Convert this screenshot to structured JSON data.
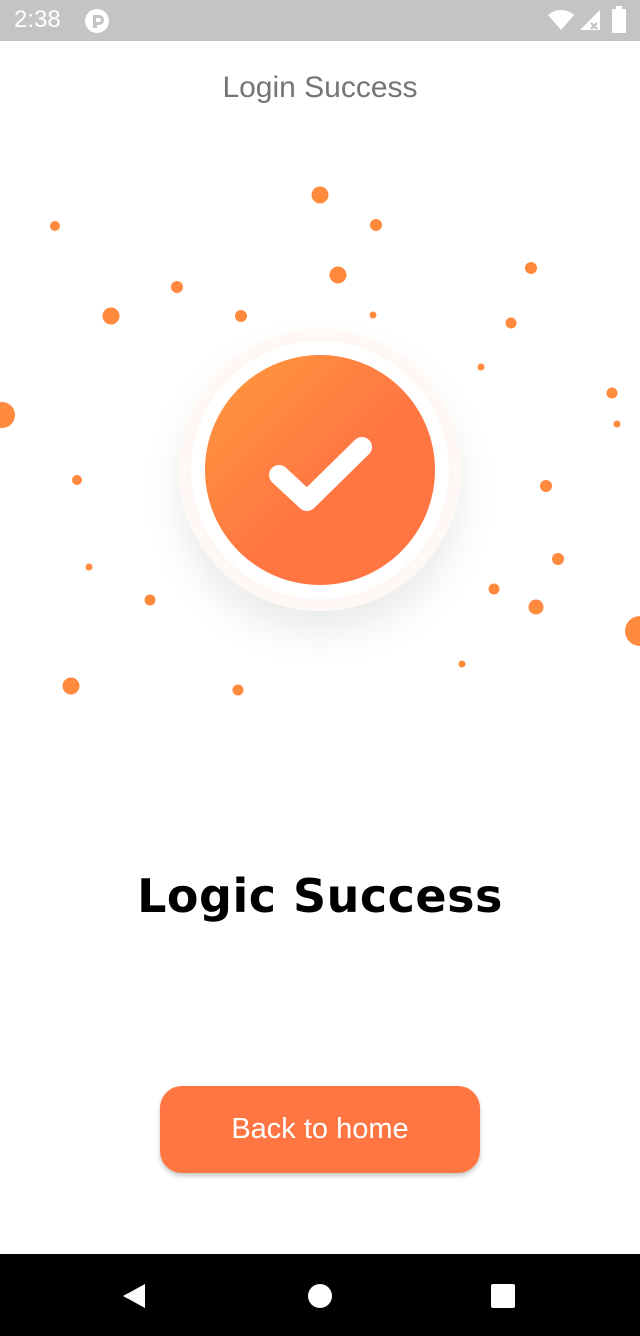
{
  "status_bar": {
    "time": "2:38",
    "icons": [
      "app-notification-icon",
      "wifi-icon",
      "cell-signal-icon",
      "battery-icon"
    ]
  },
  "app_bar": {
    "title": "Login Success"
  },
  "illustration": {
    "icon": "check-mark-icon",
    "accent_light": "#ff9a3c",
    "accent_dark": "#ff7643"
  },
  "main": {
    "headline": "Logic Success"
  },
  "actions": {
    "back_home_label": "Back to home",
    "button_color": "#ff7643"
  },
  "nav_bar": {
    "icons": [
      "back-icon",
      "home-icon",
      "recents-icon"
    ]
  }
}
